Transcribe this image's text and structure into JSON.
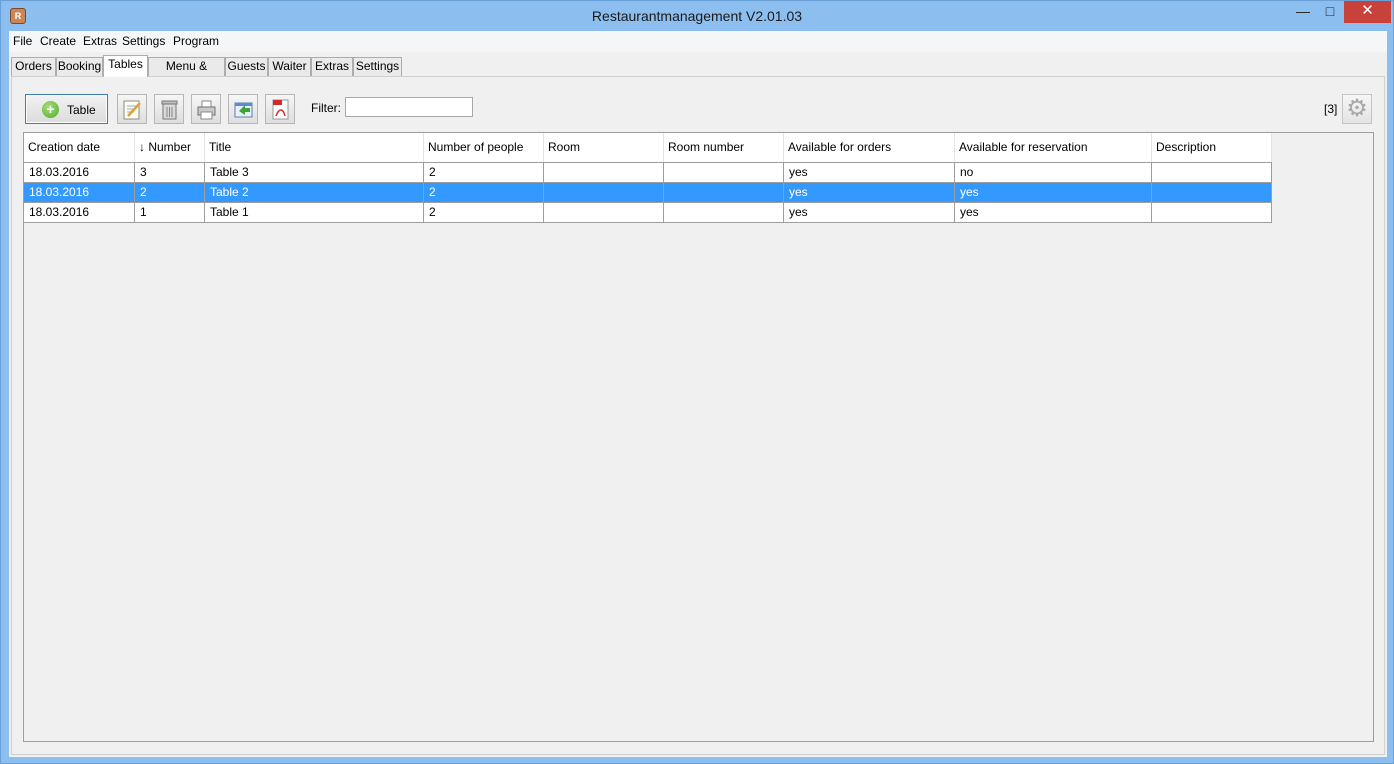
{
  "window": {
    "title": "Restaurantmanagement V2.01.03",
    "icon": "app-icon",
    "min": "—",
    "max": "□",
    "close": "✕"
  },
  "menu": [
    "File",
    "Create",
    "Extras",
    "Settings",
    "Program"
  ],
  "tabs": [
    "Orders",
    "Booking",
    "Tables",
    "Menu & Prices",
    "Guests",
    "Waiter",
    "Extras",
    "Settings"
  ],
  "active_tab": "Tables",
  "toolbar": {
    "add_label": "Table",
    "tools": [
      "edit-icon",
      "delete-icon",
      "print-icon",
      "export-icon",
      "pdf-icon"
    ],
    "filter_label": "Filter:",
    "filter_value": "",
    "count": "[3]",
    "settings_icon": "gear-icon"
  },
  "table": {
    "columns": [
      "Creation date",
      "↓ Number",
      "Title",
      "Number of people",
      "Room",
      "Room number",
      "Available for orders",
      "Available for reservation",
      "Description"
    ],
    "rows": [
      [
        "18.03.2016",
        "3",
        "Table 3",
        "2",
        "",
        "",
        "yes",
        "no",
        ""
      ],
      [
        "18.03.2016",
        "2",
        "Table 2",
        "2",
        "",
        "",
        "yes",
        "yes",
        ""
      ],
      [
        "18.03.2016",
        "1",
        "Table 1",
        "2",
        "",
        "",
        "yes",
        "yes",
        ""
      ]
    ],
    "selected_row": 1
  },
  "colors": {
    "titlebar": "#8dbef0",
    "selection": "#3399ff",
    "close": "#c8413a"
  }
}
